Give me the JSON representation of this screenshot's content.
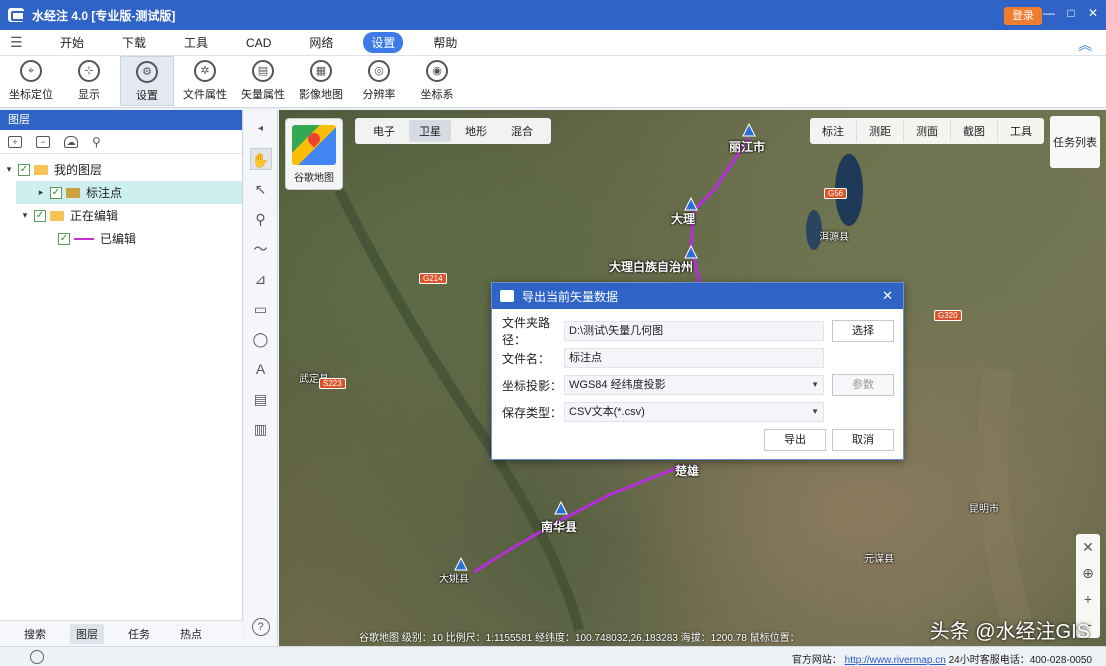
{
  "app": {
    "title": "水经注 4.0 [专业版-测试版]",
    "login_label": "登录",
    "win_buttons": [
      "—",
      "□",
      "✕"
    ]
  },
  "menu": [
    "开始",
    "下载",
    "工具",
    "CAD",
    "网络",
    "设置",
    "帮助"
  ],
  "menu_active_index": 5,
  "toolbar": [
    {
      "label": "坐标定位",
      "icon": "locate-icon"
    },
    {
      "label": "显示",
      "icon": "display-icon"
    },
    {
      "label": "设置",
      "icon": "settings-icon"
    },
    {
      "label": "文件属性",
      "icon": "file-props-icon"
    },
    {
      "label": "矢量属性",
      "icon": "vector-props-icon"
    },
    {
      "label": "影像地图",
      "icon": "image-map-icon"
    },
    {
      "label": "分辨率",
      "icon": "resolution-icon"
    },
    {
      "label": "坐标系",
      "icon": "coord-system-icon"
    }
  ],
  "left_panel": {
    "header": "图层",
    "tree": [
      {
        "label": "我的图层",
        "level": 0,
        "arrow": "▾",
        "icon": "folder"
      },
      {
        "label": "标注点",
        "level": 1,
        "arrow": "▸",
        "icon": "layer",
        "selected": true
      },
      {
        "label": "正在编辑",
        "level": 1,
        "arrow": "▾",
        "icon": "folder"
      },
      {
        "label": "已编辑",
        "level": 2,
        "arrow": "",
        "icon": "line"
      }
    ],
    "tabs": [
      "搜索",
      "图层",
      "任务",
      "热点"
    ],
    "active_tab": 1
  },
  "map": {
    "logo_label": "谷歌地图",
    "types": [
      "电子",
      "卫星",
      "地形",
      "混合"
    ],
    "active_type": 1,
    "tools": [
      "标注",
      "测距",
      "测面",
      "截图",
      "工具"
    ],
    "task_label": "任务列表",
    "labels": [
      {
        "text": "丽江市"
      },
      {
        "text": "大理"
      },
      {
        "text": "洱源县"
      },
      {
        "text": "楚雄"
      },
      {
        "text": "南华县"
      },
      {
        "text": "大理白族自治州"
      },
      {
        "text": "大姚县"
      },
      {
        "text": "元谋县"
      },
      {
        "text": "武定县"
      },
      {
        "text": "昆明市"
      }
    ],
    "shields": [
      "G214",
      "G320",
      "G56",
      "S223"
    ],
    "status": "谷歌地图   级别：10   比例尺：1:1155581   经纬度：100.748032,26.183283   海拔：1200.78   鼠标位置：",
    "watermark": "头条 @水经注GIS",
    "zoom_buttons": [
      "✕",
      "⊕",
      "+",
      "−"
    ]
  },
  "dialog": {
    "title": "导出当前矢量数据",
    "fields": [
      {
        "label": "文件夹路径：",
        "value": "D:\\测试\\矢量几何图"
      },
      {
        "label": "文件名：",
        "value": "标注点"
      },
      {
        "label": "坐标投影：",
        "value": "WGS84 经纬度投影",
        "dropdown": true
      },
      {
        "label": "保存类型：",
        "value": "CSV文本(*.csv)",
        "dropdown": true
      }
    ],
    "browse_label": "选择",
    "settings_label": "参数",
    "ok_label": "导出",
    "cancel_label": "取消"
  },
  "statusbar": {
    "site_label": "官方网站：",
    "site_url": "http://www.rivermap.cn",
    "hotline": "24小时客服电话：400-028-0050"
  },
  "colors": {
    "titlebar": "#2f63c6",
    "accent": "#3d7ce8",
    "route": "#b52fd8",
    "login": "#f07d2d"
  }
}
